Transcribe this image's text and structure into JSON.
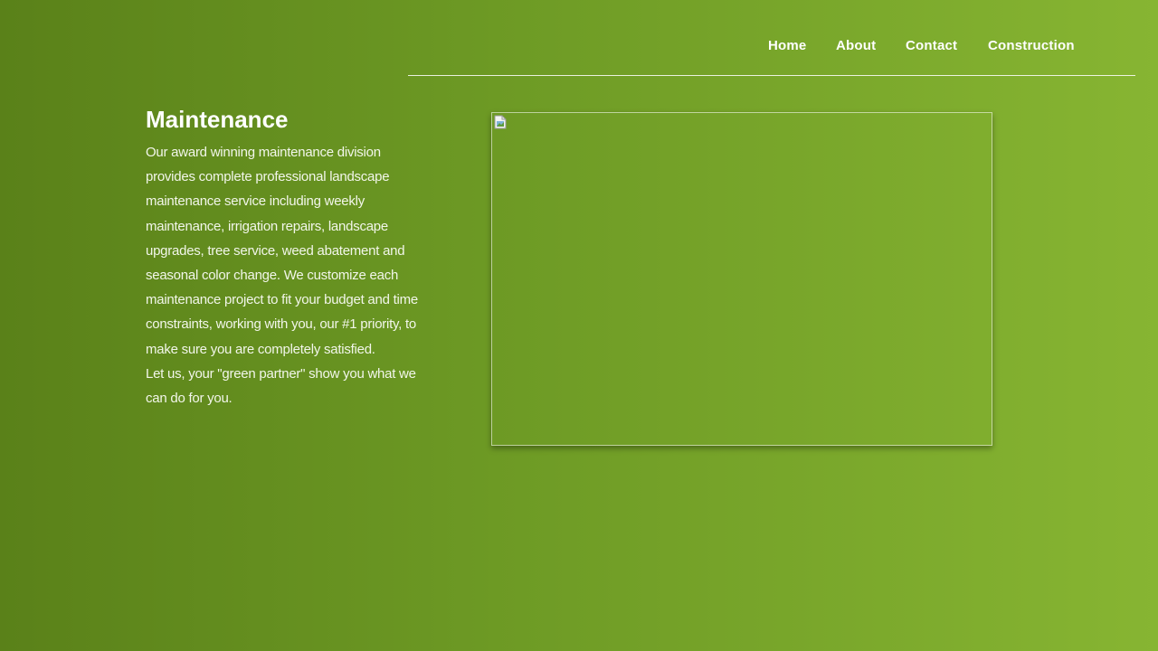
{
  "nav": {
    "items": [
      {
        "label": "Home"
      },
      {
        "label": "About"
      },
      {
        "label": "Contact"
      },
      {
        "label": "Construction"
      }
    ]
  },
  "main": {
    "title": "Maintenance",
    "paragraph1": "Our award winning maintenance division provides complete professional landscape maintenance service including weekly maintenance, irrigation repairs, landscape upgrades, tree service, weed abatement and seasonal color change. We customize each maintenance project to fit your budget and time constraints, working with you, our #1 priority, to make sure you are completely satisfied.",
    "paragraph2": "Let us, your \"green partner\" show you what we can do for you.",
    "image_icon": "broken-image-icon"
  },
  "colors": {
    "background_start": "#5a8119",
    "background_end": "#87b532",
    "text": "#ffffff"
  }
}
